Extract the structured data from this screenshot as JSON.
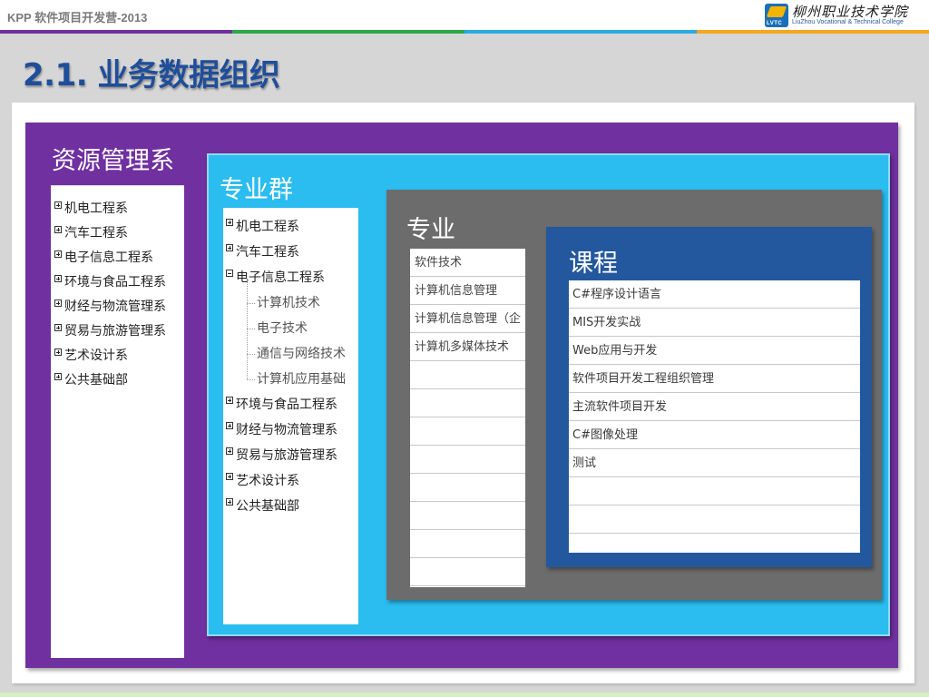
{
  "header": {
    "title": "KPP 软件项目开发营-2013",
    "strip_colors": [
      "#7030a0",
      "#2aa84a",
      "#29abe2",
      "#f5a623"
    ]
  },
  "logo": {
    "mark_text": "LVTC",
    "name_cn": "柳州职业技术学院",
    "name_en": "LiuZhou Vocational & Technical College"
  },
  "slide": {
    "title": "2.1. 业务数据组织"
  },
  "departments": {
    "title": "资源管理系",
    "items": [
      {
        "label": "机电工程系"
      },
      {
        "label": "汽车工程系"
      },
      {
        "label": "电子信息工程系"
      },
      {
        "label": "环境与食品工程系"
      },
      {
        "label": "财经与物流管理系"
      },
      {
        "label": "贸易与旅游管理系"
      },
      {
        "label": "艺术设计系"
      },
      {
        "label": "公共基础部"
      }
    ]
  },
  "major_groups": {
    "title": "专业群",
    "items_before": [
      {
        "label": "机电工程系"
      },
      {
        "label": "汽车工程系"
      }
    ],
    "expanded": {
      "label": "电子信息工程系",
      "children": [
        "计算机技术",
        "电子技术",
        "通信与网络技术",
        "计算机应用基础"
      ]
    },
    "items_after": [
      {
        "label": "环境与食品工程系"
      },
      {
        "label": "财经与物流管理系"
      },
      {
        "label": "贸易与旅游管理系"
      },
      {
        "label": "艺术设计系"
      },
      {
        "label": "公共基础部"
      }
    ]
  },
  "majors": {
    "title": "专业",
    "rows": [
      "软件技术",
      "计算机信息管理",
      "计算机信息管理（企",
      "计算机多媒体技术",
      "",
      "",
      "",
      "",
      "",
      "",
      "",
      ""
    ]
  },
  "courses": {
    "title": "课程",
    "rows": [
      "C#程序设计语言",
      "MIS开发实战",
      "Web应用与开发",
      "软件项目开发工程组织管理",
      "主流软件项目开发",
      "C#图像处理",
      "测试",
      "",
      "",
      ""
    ]
  }
}
